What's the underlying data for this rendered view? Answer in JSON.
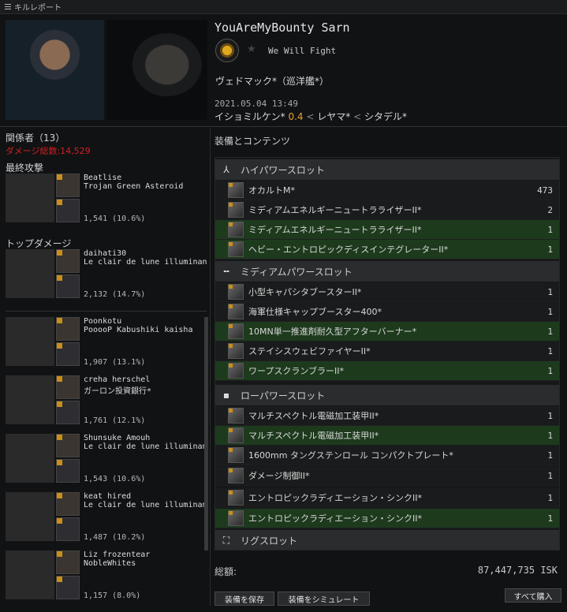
{
  "window": {
    "title": "キルレポート"
  },
  "victim": {
    "name": "YouAreMyBounty Sarn",
    "corporation": "We Will Fight",
    "ship": "ヴェドマック*（巡洋艦*）",
    "datetime": "2021.05.04 13:49",
    "location": {
      "system": "イショミルケン*",
      "security": "0.4",
      "constellation": "レヤマ*",
      "region": "シタデル*",
      "separator": "<"
    }
  },
  "involved": {
    "title": "関係者（13）",
    "damage_total": "ダメージ総数:14,529",
    "final_blow_label": "最終攻撃",
    "top_damage_label": "トップダメージ",
    "final_blow": {
      "name": "Beatlise",
      "corp": "Trojan Green Asteroid",
      "damage": "1,541 (10.6%)"
    },
    "top_damage": {
      "name": "daihati30",
      "corp": "Le clair de lune illuminan",
      "damage": "2,132 (14.7%)"
    },
    "list": [
      {
        "name": "Poonkotu",
        "corp": "PooooP Kabushiki kaisha",
        "damage": "1,907 (13.1%)"
      },
      {
        "name": "creha herschel",
        "corp": "ガーロン投資銀行*",
        "damage": "1,761 (12.1%)"
      },
      {
        "name": "Shunsuke Amouh",
        "corp": "Le clair de lune illuminan",
        "damage": "1,543 (10.6%)"
      },
      {
        "name": "keat hired",
        "corp": "Le clair de lune illuminan",
        "damage": "1,487 (10.2%)"
      },
      {
        "name": "Liz frozentear",
        "corp": "NobleWhites",
        "damage": "1,157 (8.0%)"
      }
    ]
  },
  "fitting": {
    "title": "装備とコンテンツ",
    "high": {
      "label": "ハイパワースロット",
      "items": [
        {
          "name": "オカルトM*",
          "qty": "473",
          "state": "drop"
        },
        {
          "name": "ミディアムエネルギーニュートラライザーII*",
          "qty": "2",
          "state": "drop"
        },
        {
          "name": "ミディアムエネルギーニュートラライザーII*",
          "qty": "1",
          "state": "dest"
        },
        {
          "name": "ヘビー・エントロピックディスインテグレーターII*",
          "qty": "1",
          "state": "dest"
        }
      ]
    },
    "mid": {
      "label": "ミディアムパワースロット",
      "items": [
        {
          "name": "小型キャパシタブースターII*",
          "qty": "1",
          "state": "drop"
        },
        {
          "name": "海軍仕様キャップブースター400*",
          "qty": "1",
          "state": "drop"
        },
        {
          "name": "10MN単一推進剤耐久型アフターバーナー*",
          "qty": "1",
          "state": "dest"
        },
        {
          "name": "ステイシスウェビファイヤーII*",
          "qty": "1",
          "state": "drop"
        },
        {
          "name": "ワープスクランブラーII*",
          "qty": "1",
          "state": "dest"
        }
      ]
    },
    "low": {
      "label": "ローパワースロット",
      "items": [
        {
          "name": "マルチスペクトル電磁加工装甲II*",
          "qty": "1",
          "state": "drop"
        },
        {
          "name": "マルチスペクトル電磁加工装甲II*",
          "qty": "1",
          "state": "dest"
        },
        {
          "name": "1600mm タングステンロール コンパクトプレート*",
          "qty": "1",
          "state": "drop"
        },
        {
          "name": "ダメージ制御II*",
          "qty": "1",
          "state": "drop"
        },
        {
          "name": "エントロピックラディエーション・シンクII*",
          "qty": "1",
          "state": "drop"
        },
        {
          "name": "エントロピックラディエーション・シンクII*",
          "qty": "1",
          "state": "dest"
        }
      ]
    },
    "rig": {
      "label": "リグスロット"
    }
  },
  "footer": {
    "total_label": "総額:",
    "total_value": "87,447,735 ISK",
    "save_fit": "装備を保存",
    "simulate_fit": "装備をシミュレート",
    "buy_all": "すべて購入"
  },
  "colors": {
    "dropped_row": "#1a1b1c",
    "destroyed_row": "#1d3a1d",
    "security": "#e8a030",
    "damage_total": "#d42020"
  }
}
